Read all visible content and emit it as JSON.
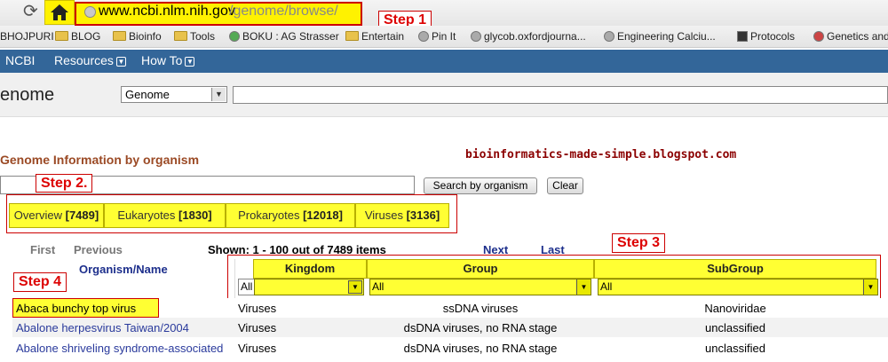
{
  "browser": {
    "url_host": "www.ncbi.nlm.nih.gov",
    "url_path": "/genome/browse/",
    "bookmarks": [
      "BHOJPURI",
      "BLOG",
      "Bioinfo",
      "Tools",
      "BOKU : AG Strasser",
      "Entertain",
      "Pin It",
      "glycob.oxfordjourna...",
      "Engineering Calciu...",
      "Protocols",
      "Genetics and"
    ]
  },
  "annotations": {
    "step1": "Step 1",
    "step2": "Step 2.",
    "step3": "Step 3",
    "step4": "Step 4"
  },
  "ncbi": {
    "logo": "NCBI",
    "menu_resources": "Resources",
    "menu_howto": "How To",
    "page_title": "enome",
    "db_select": "Genome"
  },
  "content": {
    "section_heading": "Genome Information by organism",
    "watermark": "bioinformatics-made-simple.blogspot.com",
    "search_button": "Search by organism",
    "clear_button": "Clear",
    "tabs": [
      {
        "label": "Overview",
        "count": "[7489]"
      },
      {
        "label": "Eukaryotes",
        "count": "[1830]"
      },
      {
        "label": "Prokaryotes",
        "count": "[12018]"
      },
      {
        "label": "Viruses",
        "count": "[3136]"
      }
    ],
    "paging": {
      "first": "First",
      "previous": "Previous",
      "shown": "Shown: 1 - 100 out of 7489 items",
      "next": "Next",
      "last": "Last"
    }
  },
  "table": {
    "columns": {
      "organism": "Organism/Name",
      "kingdom": "Kingdom",
      "group": "Group",
      "subgroup": "SubGroup"
    },
    "filters": {
      "kingdom": "All",
      "group": "All",
      "subgroup": "All"
    },
    "rows": [
      {
        "organism": "Abaca bunchy top virus",
        "kingdom": "Viruses",
        "group": "ssDNA viruses",
        "subgroup": "Nanoviridae"
      },
      {
        "organism": "Abalone herpesvirus Taiwan/2004",
        "kingdom": "Viruses",
        "group": "dsDNA viruses, no RNA stage",
        "subgroup": "unclassified"
      },
      {
        "organism": "Abalone shriveling syndrome-associated",
        "kingdom": "Viruses",
        "group": "dsDNA viruses, no RNA stage",
        "subgroup": "unclassified"
      }
    ]
  }
}
